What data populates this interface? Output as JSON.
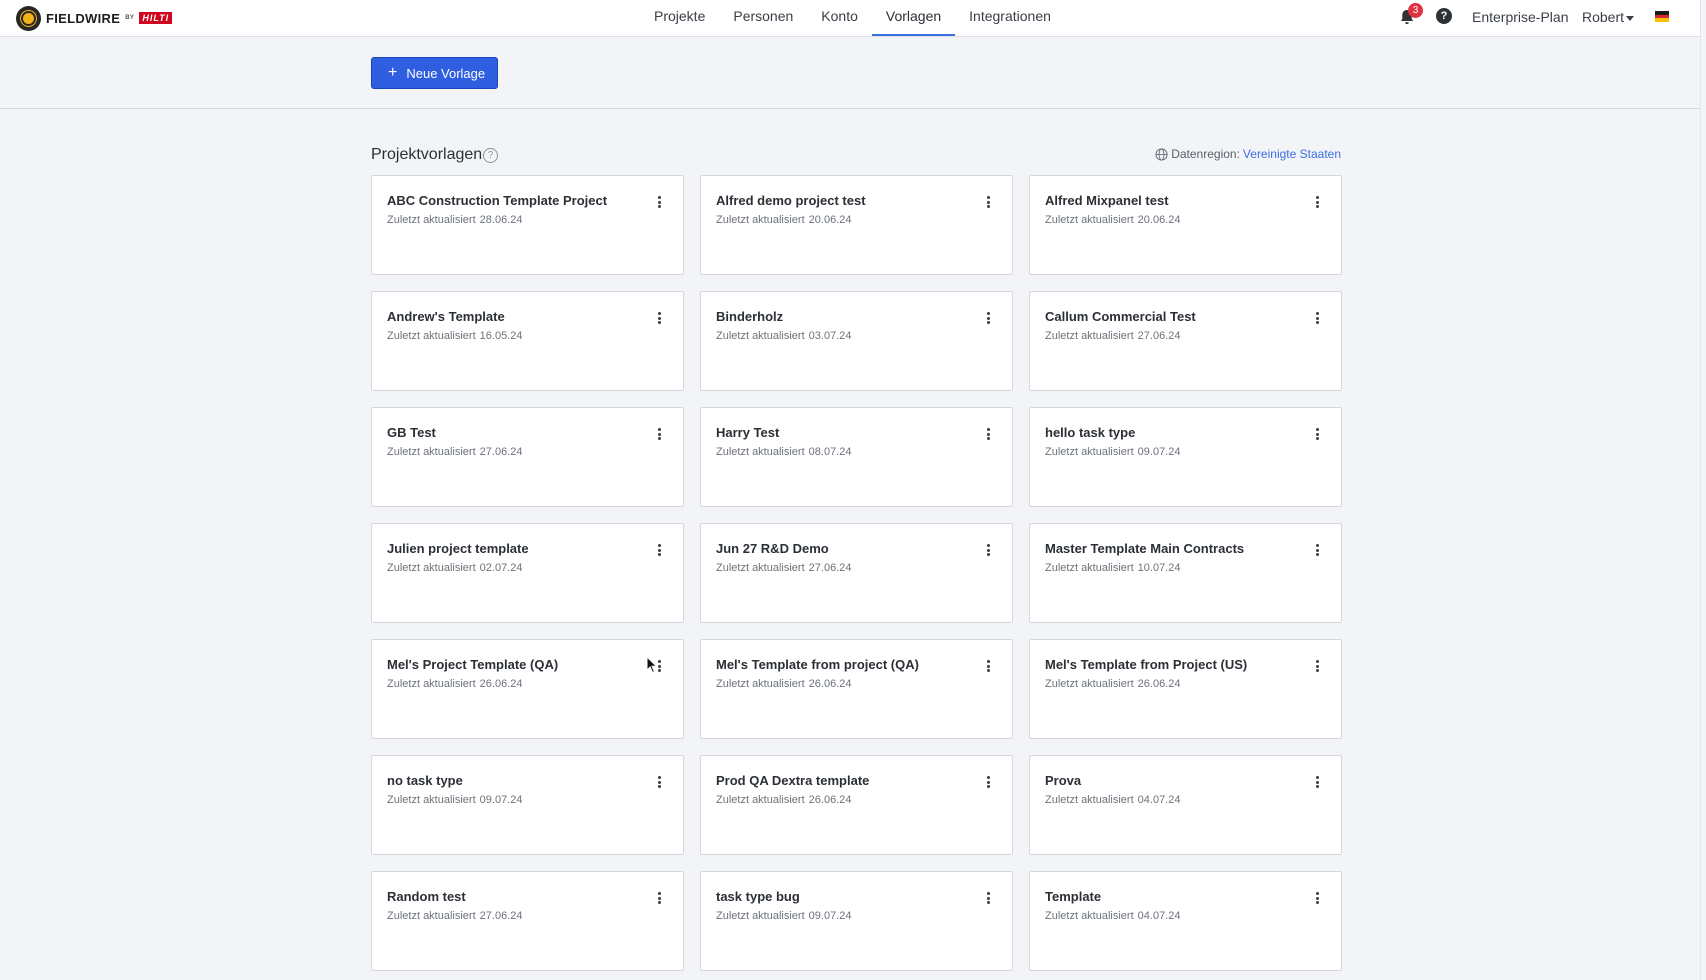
{
  "header": {
    "logo": {
      "brand": "FIELDWIRE",
      "by": "BY",
      "partner": "HILTI"
    },
    "nav": [
      {
        "label": "Projekte",
        "active": false
      },
      {
        "label": "Personen",
        "active": false
      },
      {
        "label": "Konto",
        "active": false
      },
      {
        "label": "Vorlagen",
        "active": true
      },
      {
        "label": "Integrationen",
        "active": false
      }
    ],
    "notifications_count": "3",
    "help_symbol": "?",
    "plan": "Enterprise-Plan",
    "user": "Robert",
    "language_flag": "de-flag-icon"
  },
  "toolbar": {
    "new_template_label": "Neue Vorlage"
  },
  "section": {
    "title": "Projektvorlagen",
    "help_symbol": "?",
    "region_label": "Datenregion:",
    "region_value": "Vereinigte Staaten"
  },
  "templates": [
    {
      "name": "ABC Construction Template Project",
      "updated_prefix": "Zuletzt aktualisiert",
      "updated_date": "28.06.24"
    },
    {
      "name": "Alfred demo project test",
      "updated_prefix": "Zuletzt aktualisiert",
      "updated_date": "20.06.24"
    },
    {
      "name": "Alfred Mixpanel test",
      "updated_prefix": "Zuletzt aktualisiert",
      "updated_date": "20.06.24"
    },
    {
      "name": "Andrew's Template",
      "updated_prefix": "Zuletzt aktualisiert",
      "updated_date": "16.05.24"
    },
    {
      "name": "Binderholz",
      "updated_prefix": "Zuletzt aktualisiert",
      "updated_date": "03.07.24"
    },
    {
      "name": "Callum Commercial Test",
      "updated_prefix": "Zuletzt aktualisiert",
      "updated_date": "27.06.24"
    },
    {
      "name": "GB Test",
      "updated_prefix": "Zuletzt aktualisiert",
      "updated_date": "27.06.24"
    },
    {
      "name": "Harry Test",
      "updated_prefix": "Zuletzt aktualisiert",
      "updated_date": "08.07.24"
    },
    {
      "name": "hello task type",
      "updated_prefix": "Zuletzt aktualisiert",
      "updated_date": "09.07.24"
    },
    {
      "name": "Julien project template",
      "updated_prefix": "Zuletzt aktualisiert",
      "updated_date": "02.07.24"
    },
    {
      "name": "Jun 27 R&D Demo",
      "updated_prefix": "Zuletzt aktualisiert",
      "updated_date": "27.06.24"
    },
    {
      "name": "Master Template Main Contracts",
      "updated_prefix": "Zuletzt aktualisiert",
      "updated_date": "10.07.24"
    },
    {
      "name": "Mel's Project Template (QA)",
      "updated_prefix": "Zuletzt aktualisiert",
      "updated_date": "26.06.24"
    },
    {
      "name": "Mel's Template from project (QA)",
      "updated_prefix": "Zuletzt aktualisiert",
      "updated_date": "26.06.24"
    },
    {
      "name": "Mel's Template from Project (US)",
      "updated_prefix": "Zuletzt aktualisiert",
      "updated_date": "26.06.24"
    },
    {
      "name": "no task type",
      "updated_prefix": "Zuletzt aktualisiert",
      "updated_date": "09.07.24"
    },
    {
      "name": "Prod QA Dextra template",
      "updated_prefix": "Zuletzt aktualisiert",
      "updated_date": "26.06.24"
    },
    {
      "name": "Prova",
      "updated_prefix": "Zuletzt aktualisiert",
      "updated_date": "04.07.24"
    },
    {
      "name": "Random test",
      "updated_prefix": "Zuletzt aktualisiert",
      "updated_date": "27.06.24"
    },
    {
      "name": "task type bug",
      "updated_prefix": "Zuletzt aktualisiert",
      "updated_date": "09.07.24"
    },
    {
      "name": "Template",
      "updated_prefix": "Zuletzt aktualisiert",
      "updated_date": "04.07.24"
    }
  ],
  "colors": {
    "accent": "#2f5fe0",
    "link": "#3b6fe0",
    "badge": "#e0333e",
    "background": "#f3f4f7"
  }
}
